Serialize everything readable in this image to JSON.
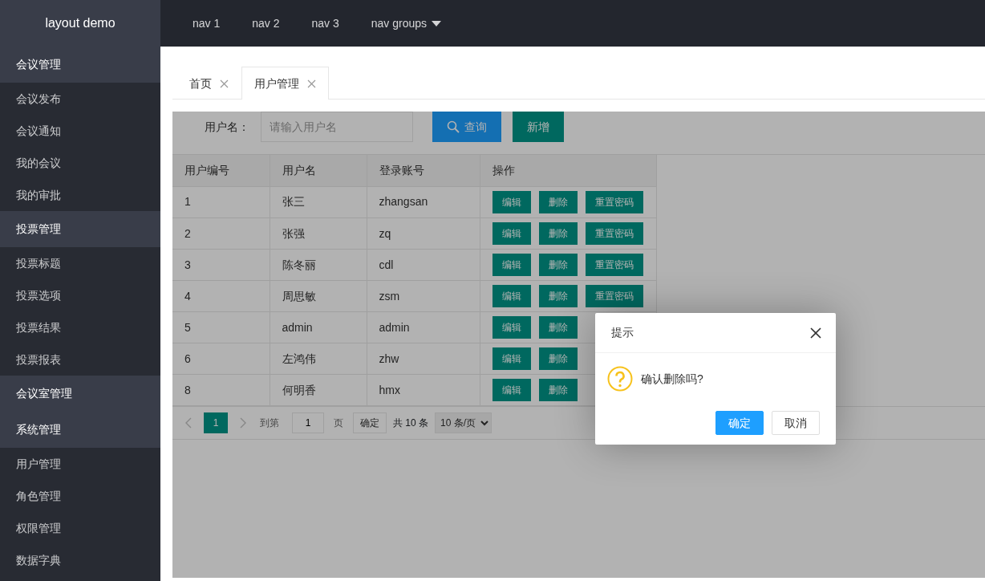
{
  "brand": "layout demo",
  "top_nav": [
    {
      "label": "nav 1",
      "has_dropdown": false
    },
    {
      "label": "nav 2",
      "has_dropdown": false
    },
    {
      "label": "nav 3",
      "has_dropdown": false
    },
    {
      "label": "nav groups",
      "has_dropdown": true
    }
  ],
  "sidebar": {
    "groups": [
      {
        "label": "会议管理",
        "children": [
          {
            "label": "会议发布"
          },
          {
            "label": "会议通知"
          },
          {
            "label": "我的会议"
          },
          {
            "label": "我的审批"
          }
        ]
      },
      {
        "label": "投票管理",
        "children": [
          {
            "label": "投票标题"
          },
          {
            "label": "投票选项"
          },
          {
            "label": "投票结果"
          },
          {
            "label": "投票报表"
          }
        ]
      },
      {
        "label": "会议室管理"
      },
      {
        "label": "系统管理",
        "children": [
          {
            "label": "用户管理"
          },
          {
            "label": "角色管理"
          },
          {
            "label": "权限管理"
          },
          {
            "label": "数据字典"
          }
        ]
      }
    ]
  },
  "tabs": [
    {
      "label": "首页",
      "selected": false
    },
    {
      "label": "用户管理",
      "selected": true
    }
  ],
  "search": {
    "label": "用户名：",
    "placeholder": "请输入用户名",
    "buttons": [
      {
        "label": "查询",
        "kind": "search"
      },
      {
        "label": "新增",
        "kind": "add"
      }
    ]
  },
  "table": {
    "columns": [
      "用户编号",
      "用户名",
      "登录账号",
      "操作"
    ],
    "rows": [
      {
        "cells": [
          "1",
          "张三",
          "zhangsan"
        ],
        "actions": [
          "编辑",
          "删除",
          "重置密码"
        ]
      },
      {
        "cells": [
          "2",
          "张强",
          "zq"
        ],
        "actions": [
          "编辑",
          "删除",
          "重置密码"
        ]
      },
      {
        "cells": [
          "3",
          "陈冬丽",
          "cdl"
        ],
        "actions": [
          "编辑",
          "删除",
          "重置密码"
        ]
      },
      {
        "cells": [
          "4",
          "周思敏",
          "zsm"
        ],
        "actions": [
          "编辑",
          "删除",
          "重置密码"
        ]
      },
      {
        "cells": [
          "5",
          "admin",
          "admin"
        ],
        "actions": [
          "编辑",
          "删除"
        ]
      },
      {
        "cells": [
          "6",
          "左鸿伟",
          "zhw"
        ],
        "actions": [
          "编辑",
          "删除"
        ]
      },
      {
        "cells": [
          "8",
          "何明香",
          "hmx"
        ],
        "actions": [
          "编辑",
          "删除"
        ]
      }
    ]
  },
  "pagination": {
    "pages": [
      {
        "label": "1",
        "selected": true
      }
    ],
    "goto_label": "到第",
    "goto_value": "1",
    "page_unit": "页",
    "confirm": "确定",
    "total": "共 10 条",
    "page_size": "10 条/页"
  },
  "dialog": {
    "title": "提示",
    "message": "确认删除吗?",
    "buttons": [
      {
        "label": "确定",
        "kind": "primary"
      },
      {
        "label": "取消",
        "kind": "secondary"
      }
    ]
  }
}
